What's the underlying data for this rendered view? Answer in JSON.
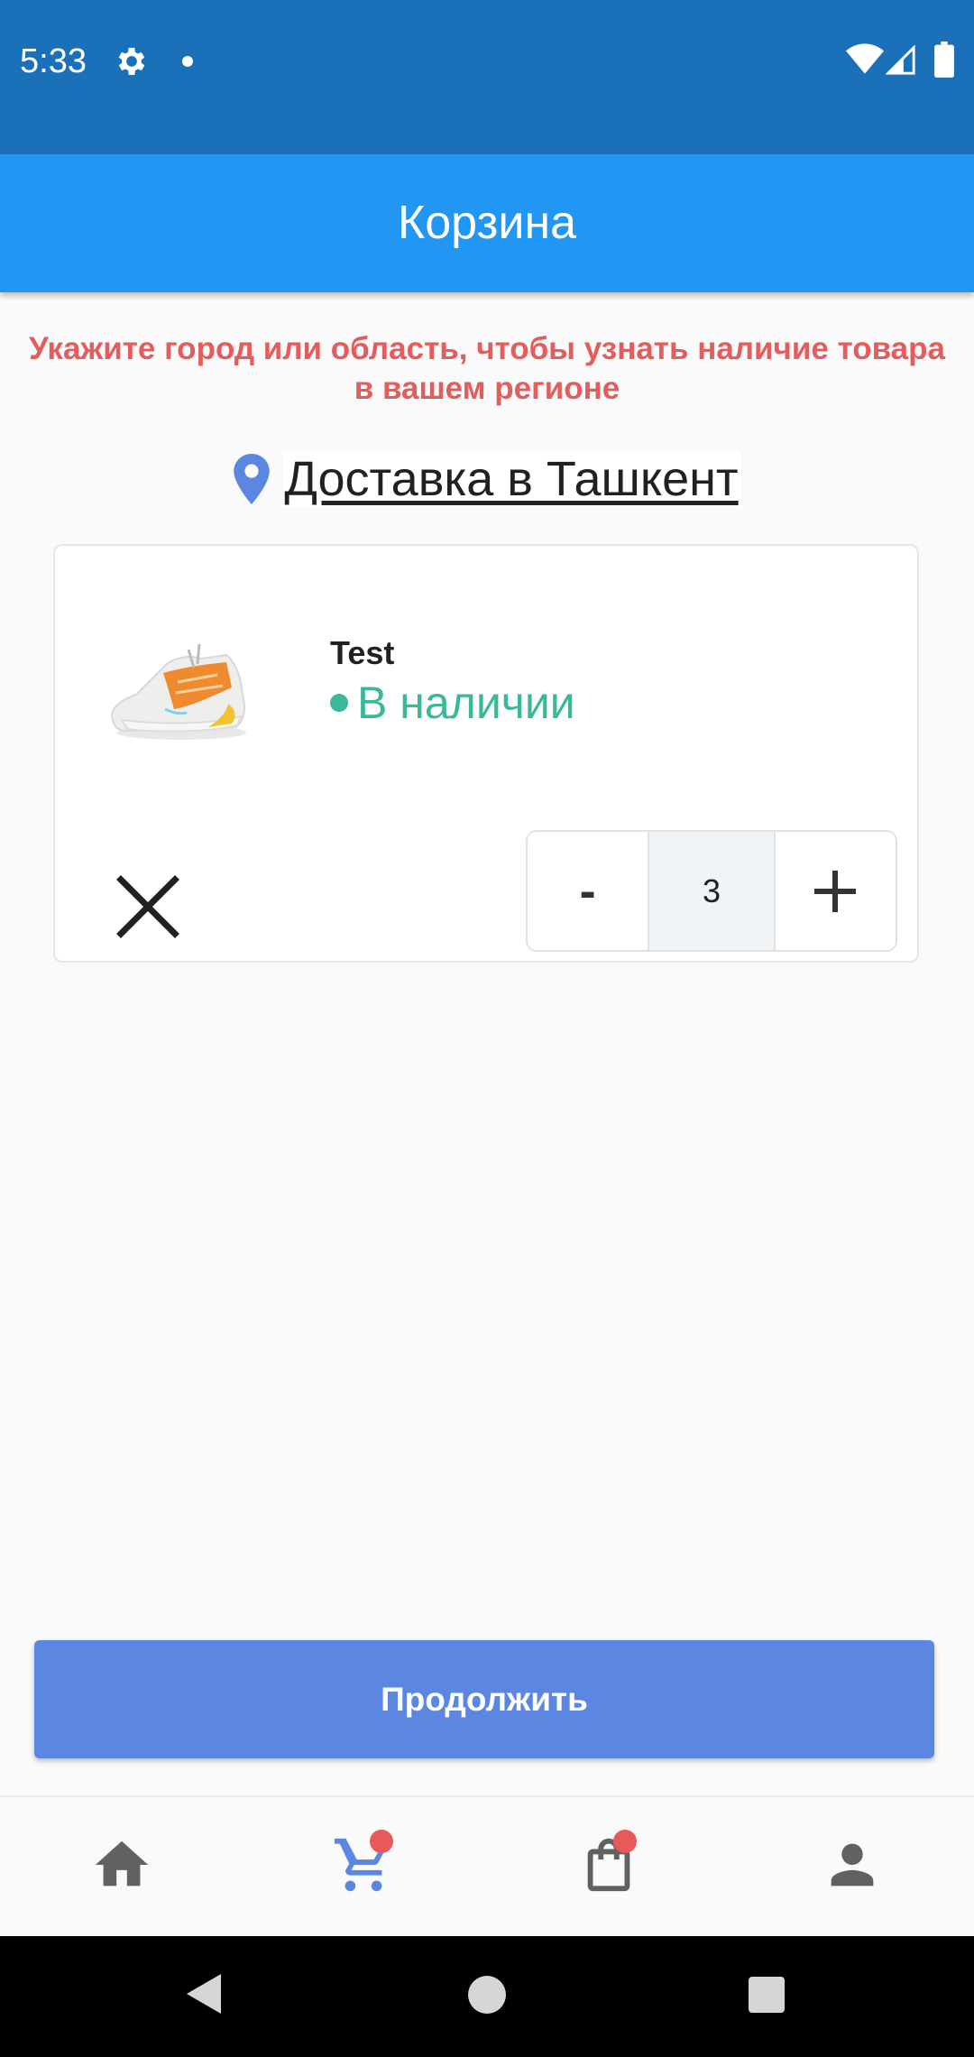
{
  "status_bar": {
    "time": "5:33",
    "icons": [
      "gear-icon",
      "notification-dot-icon",
      "wifi-icon",
      "signal-icon",
      "battery-icon"
    ],
    "background": "#1b71b9"
  },
  "app_bar": {
    "title": "Корзина",
    "background": "#2196f3"
  },
  "region_warning": {
    "line1": "Укажите город или область, чтобы узнать наличие товара",
    "line2": "в вашем регионе",
    "color": "#e35d5d"
  },
  "delivery": {
    "icon": "location-pin-icon",
    "label": "Доставка в Ташкент"
  },
  "cart": {
    "items": [
      {
        "name": "Test",
        "image": "sneaker-image",
        "stock_status": "В наличии",
        "stock_color": "#3bb79a",
        "quantity": "3",
        "decrement_label": "-",
        "increment_label": "+",
        "remove_icon": "close-icon"
      }
    ]
  },
  "continue_button": {
    "label": "Продолжить",
    "color": "#5b87e1"
  },
  "bottom_nav": {
    "items": [
      {
        "icon": "home-icon",
        "active": false,
        "badge": false
      },
      {
        "icon": "cart-icon",
        "active": true,
        "badge": true
      },
      {
        "icon": "shopping-bag-icon",
        "active": false,
        "badge": true
      },
      {
        "icon": "profile-icon",
        "active": false,
        "badge": false
      }
    ],
    "active_color": "#5b87e1",
    "inactive_color": "#616161",
    "badge_color": "#e85a5a"
  },
  "system_nav": {
    "icons": [
      "back-icon",
      "home-circle-icon",
      "recents-icon"
    ]
  }
}
